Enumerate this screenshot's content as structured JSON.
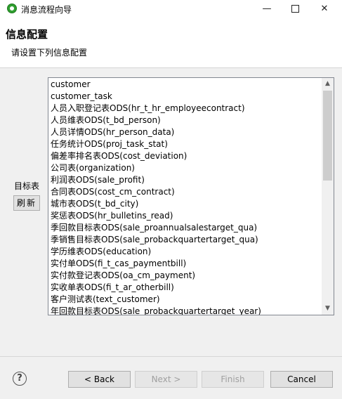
{
  "window": {
    "title": "消息流程向导",
    "minimize_glyph": "—",
    "close_glyph": "✕"
  },
  "header": {
    "title": "信息配置",
    "description": "请设置下列信息配置"
  },
  "form": {
    "target_label": "目标表",
    "refresh_label": "刷新"
  },
  "list": {
    "items": [
      "customer",
      "customer_task",
      "人员入职登记表ODS(hr_t_hr_employeecontract)",
      "人员维表ODS(t_bd_person)",
      "人员详情ODS(hr_person_data)",
      "任务统计ODS(proj_task_stat)",
      "偏差率排名表ODS(cost_deviation)",
      "公司表(organization)",
      "利润表ODS(sale_profit)",
      "合同表ODS(cost_cm_contract)",
      "城市表ODS(t_bd_city)",
      "奖惩表ODS(hr_bulletins_read)",
      "季回款目标表ODS(sale_proannualsalestarget_qua)",
      "季销售目标表ODS(sale_probackquartertarget_qua)",
      "学历维表ODS(education)",
      "实付单ODS(fi_t_cas_paymentbill)",
      "实付款登记表ODS(oa_cm_payment)",
      "实收单表ODS(fi_t_ar_otherbill)",
      "客户测试表(text_customer)",
      "年回款目标表ODS(sale_probackquartertarget_year)"
    ],
    "scroll_up_glyph": "▲",
    "scroll_down_glyph": "▼"
  },
  "footer": {
    "help_glyph": "?",
    "back_label": "< Back",
    "next_label": "Next >",
    "finish_label": "Finish",
    "cancel_label": "Cancel"
  }
}
